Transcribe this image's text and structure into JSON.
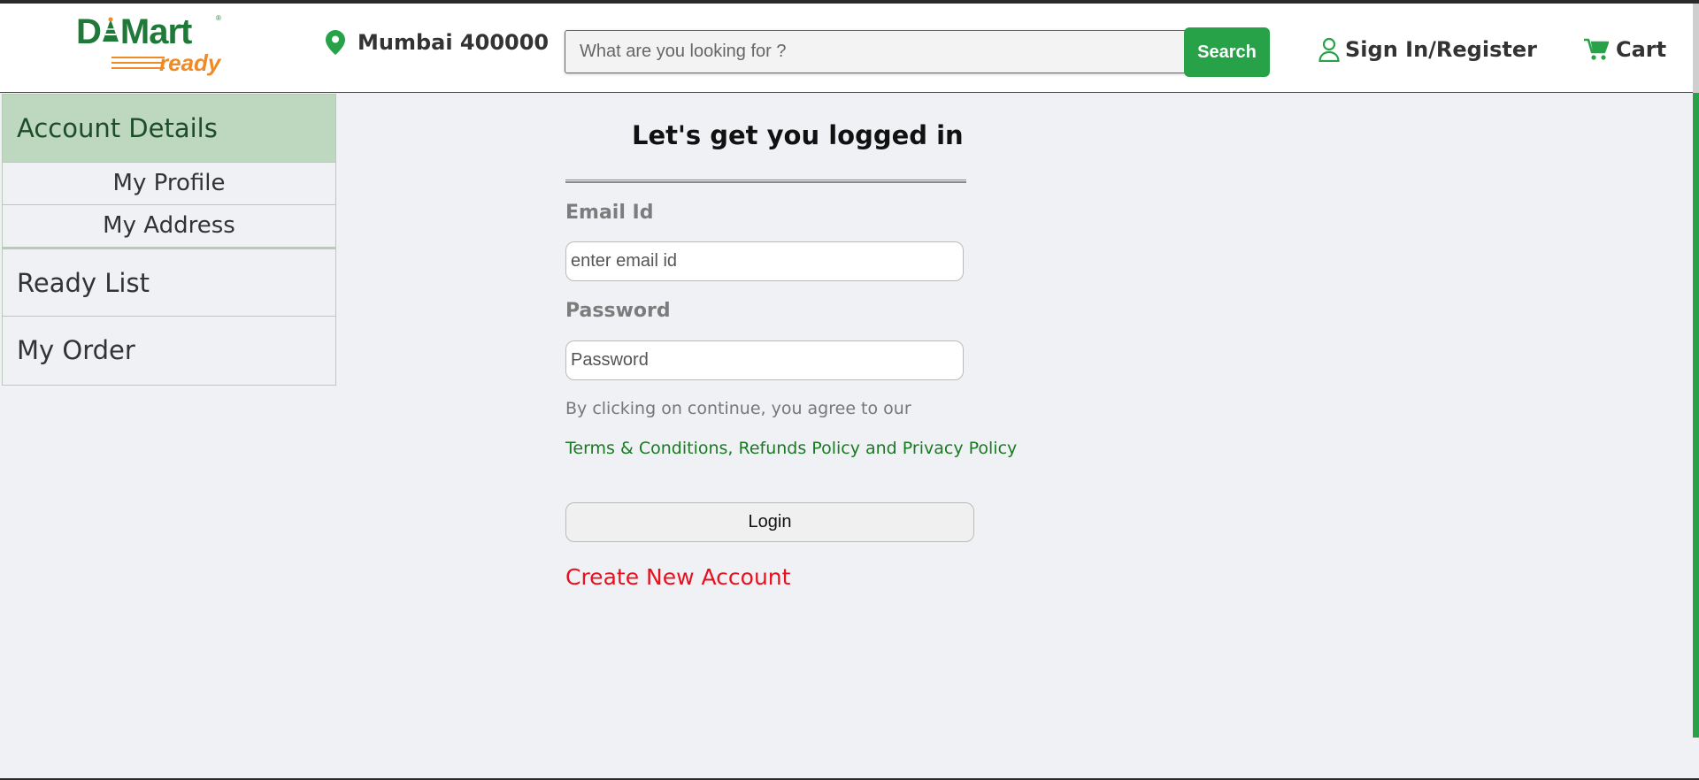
{
  "header": {
    "logo": {
      "brand": "DMart",
      "sub": "ready"
    },
    "location": "Mumbai 400000",
    "search": {
      "placeholder": "What are you looking for ?",
      "button_label": "Search"
    },
    "signin_label": "Sign In/Register",
    "cart_label": "Cart"
  },
  "sidebar": {
    "heading": "Account Details",
    "sub_items": [
      "My Profile",
      "My Address"
    ],
    "items": [
      "Ready List",
      "My Order"
    ]
  },
  "login": {
    "title": "Let's get you logged in",
    "email_label": "Email Id",
    "email_placeholder": "enter email id",
    "password_label": "Password",
    "password_placeholder": "Password",
    "agree_text": "By clicking on continue, you agree to our",
    "terms_link": "Terms & Conditions, Refunds Policy and Privacy Policy",
    "login_button": "Login",
    "create_account_link": "Create New Account"
  },
  "colors": {
    "brand_green": "#27a248",
    "brand_orange": "#f08a24",
    "sidebar_active_bg": "#bed7bf",
    "link_green": "#1a7a23",
    "create_red": "#e8111f"
  },
  "icons": [
    "location-pin-icon",
    "user-icon",
    "cart-icon"
  ]
}
